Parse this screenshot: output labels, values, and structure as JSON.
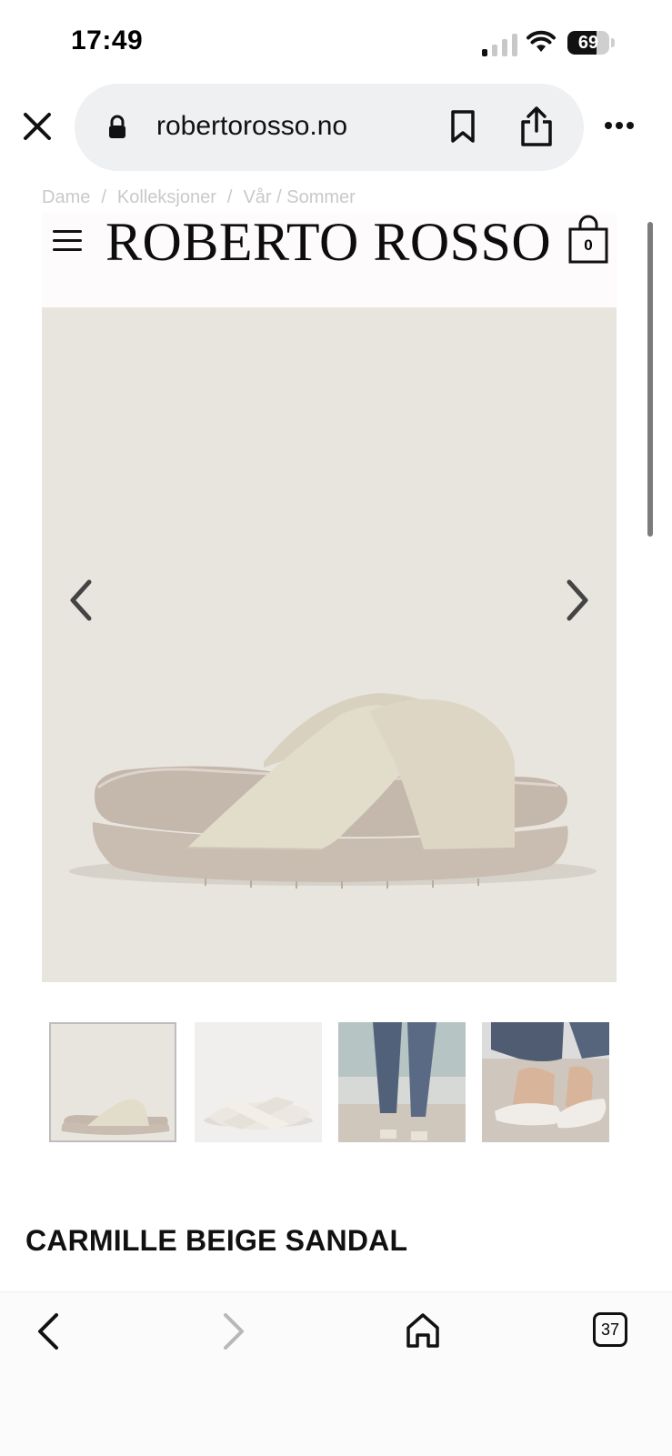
{
  "status_bar": {
    "time": "17:49",
    "battery_percent": "69",
    "battery_level": 0.69
  },
  "browser": {
    "url": "robertorosso.no"
  },
  "breadcrumb": [
    "Dame",
    "Kolleksjoner",
    "Vår / Sommer"
  ],
  "site": {
    "brand": "ROBERTO ROSSO",
    "cart_count": "0"
  },
  "gallery": {
    "thumbnails": [
      {
        "name": "thumb-side-view",
        "active": true
      },
      {
        "name": "thumb-top-view",
        "active": false
      },
      {
        "name": "thumb-model-legs",
        "active": false
      },
      {
        "name": "thumb-model-feet",
        "active": false
      }
    ]
  },
  "product": {
    "title": "CARMILLE BEIGE SANDAL"
  },
  "toolbar": {
    "tab_count": "37"
  }
}
